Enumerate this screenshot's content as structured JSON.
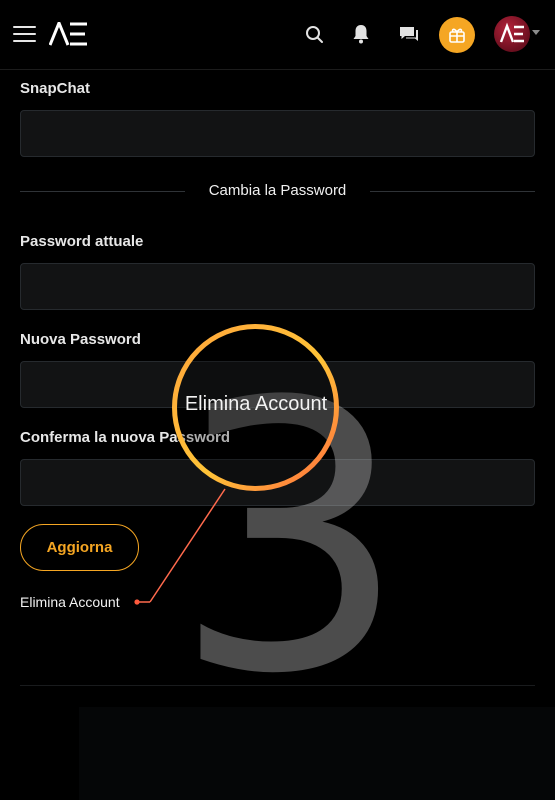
{
  "header": {
    "logo_text": "AE",
    "avatar_initials": "AE",
    "icons": [
      "menu-icon",
      "search-icon",
      "bell-icon",
      "chat-icon",
      "gift-icon",
      "chevron-down-icon"
    ],
    "accent_color": "#f5a623"
  },
  "form": {
    "snapchat_label": "SnapChat",
    "snapchat_value": "",
    "password_section_title": "Cambia la Password",
    "current_password_label": "Password attuale",
    "current_password_value": "",
    "new_password_label": "Nuova Password",
    "new_password_value": "",
    "confirm_password_label": "Conferma la nuova Password",
    "confirm_password_value": "",
    "update_button_label": "Aggiorna",
    "delete_account_label": "Elimina Account"
  },
  "annotation": {
    "step_number": "3",
    "zoom_label": "Elimina Account"
  }
}
